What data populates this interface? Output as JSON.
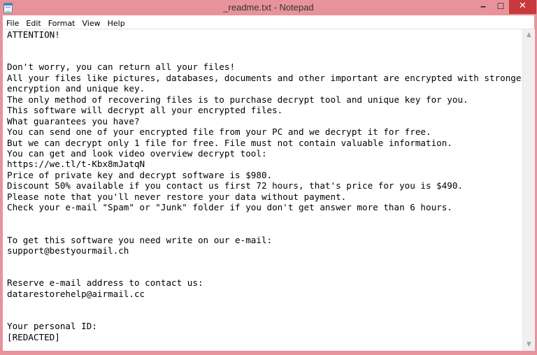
{
  "window": {
    "title": "_readme.txt - Notepad",
    "frame_color": "#e8939b",
    "close_color": "#c7393b"
  },
  "titlebar_buttons": {
    "minimize": "‒",
    "maximize": "☐",
    "close": "✕"
  },
  "menu": {
    "file": "File",
    "edit": "Edit",
    "format": "Format",
    "view": "View",
    "help": "Help"
  },
  "document": {
    "lines": [
      "ATTENTION!",
      "",
      "",
      "Don't worry, you can return all your files!",
      "All your files like pictures, databases, documents and other important are encrypted with strongest",
      "encryption and unique key.",
      "The only method of recovering files is to purchase decrypt tool and unique key for you.",
      "This software will decrypt all your encrypted files.",
      "What guarantees you have?",
      "You can send one of your encrypted file from your PC and we decrypt it for free.",
      "But we can decrypt only 1 file for free. File must not contain valuable information.",
      "You can get and look video overview decrypt tool:",
      "https://we.tl/t-Kbx8mJatqN",
      "Price of private key and decrypt software is $980.",
      "Discount 50% available if you contact us first 72 hours, that's price for you is $490.",
      "Please note that you'll never restore your data without payment.",
      "Check your e-mail \"Spam\" or \"Junk\" folder if you don't get answer more than 6 hours.",
      "",
      "",
      "To get this software you need write on our e-mail:",
      "support@bestyourmail.ch",
      "",
      "",
      "Reserve e-mail address to contact us:",
      "datarestorehelp@airmail.cc",
      "",
      "",
      "Your personal ID:",
      "[REDACTED]"
    ]
  },
  "scrollbar": {
    "up_arrow": "▲",
    "down_arrow": "▼"
  }
}
